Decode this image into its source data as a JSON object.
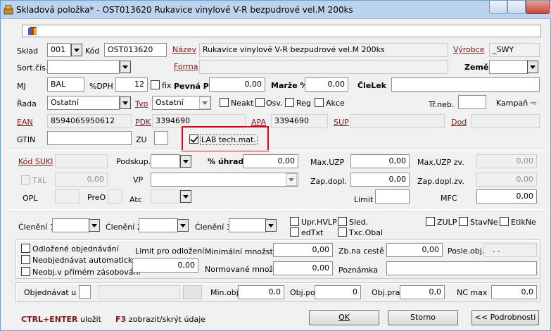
{
  "window": {
    "title": "Skladová položka* - OST013620 Rukavice vinylové V-R bezpudrové vel.M 200ks"
  },
  "row1": {
    "sklad_label": "Sklad",
    "sklad_value": "001",
    "kod_label": "Kód",
    "kod_value": "OST013620",
    "nazev_label": "Název",
    "nazev_value": "Rukavice vinylové V-R bezpudrové vel.M 200ks",
    "vyrobce_label": "Výrobce",
    "vyrobce_value": "_SWY"
  },
  "row2": {
    "sortcis_label": "Sort.čís.",
    "forma_label": "Forma",
    "zeme_label": "Země"
  },
  "row3": {
    "mj_label": "MJ",
    "mj_value": "BAL",
    "dph_label": "%DPH",
    "dph_value": "12",
    "fix_label": "fix",
    "pevna_label": "Pevná PC",
    "pevna_value": "0,00",
    "marze_label": "Marže %",
    "marze_value": "0,00",
    "clelek_label": "ČleLek"
  },
  "row4": {
    "rada_label": "Řada",
    "rada_value": "Ostatní",
    "typ_label": "Typ",
    "typ_value": "Ostatní",
    "neakt_label": "Neakt",
    "osv_label": "Osv.",
    "reg_label": "Reg",
    "akce_label": "Akce",
    "trneb_label": "Tř.neb.",
    "kampan_label": "Kampaň"
  },
  "row5": {
    "ean_label": "EAN",
    "ean_value": "8594065950612",
    "pdk_label": "PDK",
    "pdk_value": "3394690",
    "apa_label": "APA",
    "apa_value": "3394690",
    "sup_label": "SUP",
    "dod_label": "Dod"
  },
  "row6": {
    "gtin_label": "GTIN",
    "zu_label": "ZU",
    "lab_label": "LAB tech.mat.",
    "lab_checked": true
  },
  "suki": {
    "kod_suki_label": "Kód SUKI",
    "podskup_label": "Podskup.",
    "uhrady_label": "% úhrady",
    "uhrady_value": "0,00",
    "maxuzp_label": "Max.UZP",
    "maxuzp_value": "0,00",
    "maxuzpzv_label": "Max.UZP zv.",
    "maxuzpzv_value": "0,00",
    "txl_label": "TXL",
    "txl_value": "0,00",
    "vp_label": "VP",
    "zapdopl_label": "Zap.dopl.",
    "zapdopl_value": "0,00",
    "zapdoplzv_label": "Zap.dopl.zv.",
    "zapdoplzv_value": "0,00",
    "opl_label": "OPL",
    "preo_label": "PreO",
    "atc_label": "Atc",
    "limit_label": "Limit",
    "mfc_label": "MFC",
    "mfc_value": "0,00"
  },
  "cleneni": {
    "c1_label": "Členění 1",
    "c2_label": "Členění 2",
    "c3_label": "Členění 3",
    "uprhvlp_label": "Upr.HVLP",
    "sled_label": "Sled.",
    "edtxt_label": "edTxt",
    "txcobal_label": "Txc.Obal",
    "zulp_label": "ZULP",
    "stavne_label": "StavNe",
    "etikne_label": "EtikNe"
  },
  "order": {
    "odlozene_label": "Odložené objednávání",
    "neobjauto_label": "Neobjednávat automaticky",
    "neobjprimo_label": "Neobj.v přímém zásobování",
    "limitodl_label": "Limit pro odložení",
    "limitodl_value": "0,00",
    "minmn_label": "Minimální množství",
    "minmn_value": "0,00",
    "normmn_label": "Normované množství",
    "normmn_value": "0,00",
    "zbnaceste_label": "Zb.na cestě",
    "zbnaceste_value": "0,00",
    "poznamka_label": "Poznámka",
    "posleobj_label": "Posle.obj.",
    "posleobj_value": ". ."
  },
  "objrow": {
    "objednavat_label": "Objednávat u",
    "minobj_label": "Min.obj.",
    "minobj_value": "0,0",
    "objpo_label": "Obj.po",
    "objpo_value": "0",
    "objprav_label": "Obj.prav",
    "objprav_value": "0,0",
    "ncmax_label": "NC max",
    "ncmax_value": "0,0"
  },
  "footer": {
    "ctrl_key": "CTRL+ENTER",
    "ctrl_text": "uložit",
    "f3_key": "F3",
    "f3_text": "zobrazit/skrýt údaje",
    "ok_label": "OK",
    "storno_label": "Storno",
    "podrobnosti_label": "<< Podrobnosti"
  },
  "colors": {
    "link": "#7a1a1a",
    "footer_key": "#7a1a1a",
    "highlight": "#e0001a"
  }
}
